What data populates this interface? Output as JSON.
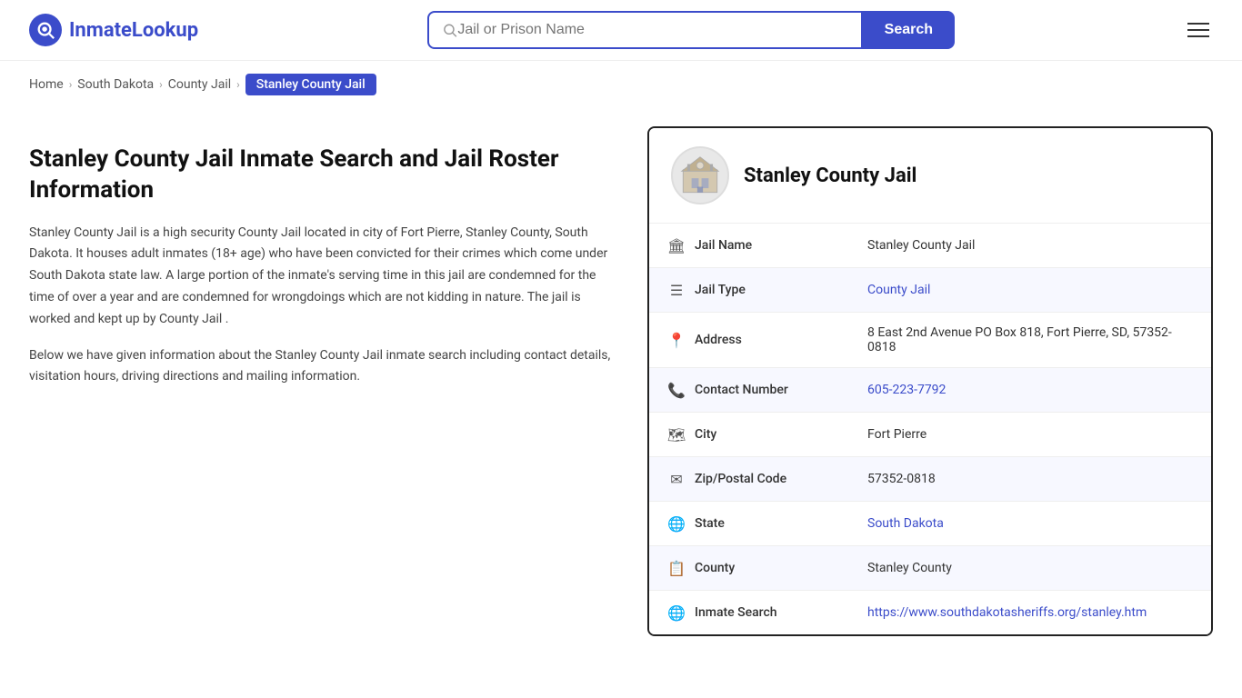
{
  "header": {
    "logo_text": "InmateLookup",
    "search_placeholder": "Jail or Prison Name",
    "search_button_label": "Search"
  },
  "breadcrumb": {
    "home": "Home",
    "state": "South Dakota",
    "type": "County Jail",
    "active": "Stanley County Jail"
  },
  "left": {
    "heading": "Stanley County Jail Inmate Search and Jail Roster Information",
    "para1": "Stanley County Jail is a high security County Jail located in city of Fort Pierre, Stanley County, South Dakota. It houses adult inmates (18+ age) who have been convicted for their crimes which come under South Dakota state law. A large portion of the inmate's serving time in this jail are condemned for the time of over a year and are condemned for wrongdoings which are not kidding in nature. The jail is worked and kept up by County Jail .",
    "para2": "Below we have given information about the Stanley County Jail inmate search including contact details, visitation hours, driving directions and mailing information."
  },
  "card": {
    "title": "Stanley County Jail",
    "rows": [
      {
        "label": "Jail Name",
        "value": "Stanley County Jail",
        "link": false,
        "icon": "🏛"
      },
      {
        "label": "Jail Type",
        "value": "County Jail",
        "link": true,
        "icon": "☰"
      },
      {
        "label": "Address",
        "value": "8 East 2nd Avenue PO Box 818, Fort Pierre, SD, 57352-0818",
        "link": false,
        "icon": "📍"
      },
      {
        "label": "Contact Number",
        "value": "605-223-7792",
        "link": true,
        "icon": "📞"
      },
      {
        "label": "City",
        "value": "Fort Pierre",
        "link": false,
        "icon": "🗺"
      },
      {
        "label": "Zip/Postal Code",
        "value": "57352-0818",
        "link": false,
        "icon": "✉"
      },
      {
        "label": "State",
        "value": "South Dakota",
        "link": true,
        "icon": "🌐"
      },
      {
        "label": "County",
        "value": "Stanley County",
        "link": false,
        "icon": "📋"
      },
      {
        "label": "Inmate Search",
        "value": "https://www.southdakotasheriffs.org/stanley.htm",
        "link": true,
        "icon": "🌐"
      }
    ]
  }
}
